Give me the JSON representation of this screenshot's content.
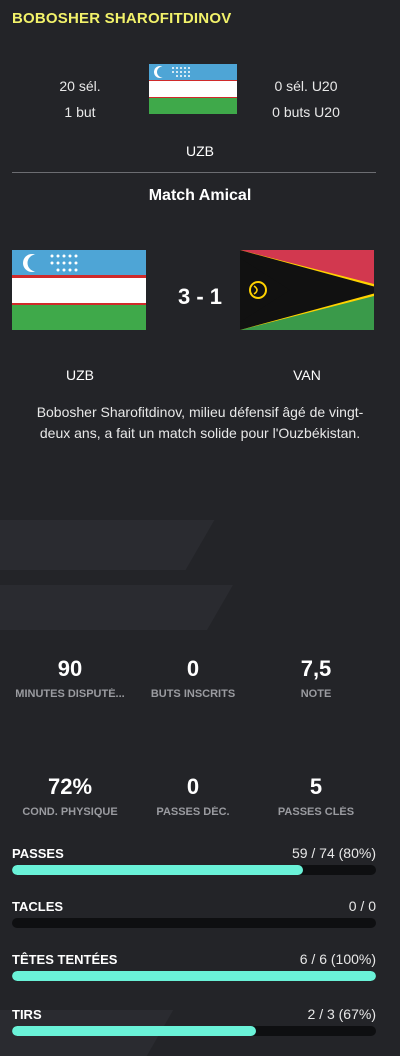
{
  "player": {
    "name": "BOBOSHER SHAROFITDINOV"
  },
  "career": {
    "caps": "20 sél.",
    "goals": "1 but",
    "u20_caps": "0 sél. U20",
    "u20_goals": "0 buts U20",
    "nation_code": "UZB"
  },
  "match": {
    "title": "Match Amical",
    "home_code": "UZB",
    "away_code": "VAN",
    "score": "3 - 1",
    "description": "Bobosher Sharofitdinov, milieu défensif âgé de vingt-deux ans, a fait un match solide pour l'Ouzbékistan."
  },
  "kpis_row1": [
    {
      "value": "90",
      "label": "MINUTES DISPUTÉ..."
    },
    {
      "value": "0",
      "label": "BUTS INSCRITS"
    },
    {
      "value": "7,5",
      "label": "NOTE"
    }
  ],
  "kpis_row2": [
    {
      "value": "72%",
      "label": "COND. PHYSIQUE"
    },
    {
      "value": "0",
      "label": "PASSES DÉC."
    },
    {
      "value": "5",
      "label": "PASSES CLÉS"
    }
  ],
  "bars": [
    {
      "label": "PASSES",
      "value": "59 / 74 (80%)",
      "fraction": 0.8
    },
    {
      "label": "TACLES",
      "value": "0 / 0",
      "fraction": 0
    },
    {
      "label": "TÊTES TENTÉES",
      "value": "6 / 6 (100%)",
      "fraction": 1.0
    },
    {
      "label": "TIRS",
      "value": "2 / 3 (67%)",
      "fraction": 0.67
    }
  ],
  "colors": {
    "name": "#f2f26a",
    "bar_fill": "#6af2d8",
    "bar_track": "#0e0f11",
    "background": "#232428"
  },
  "icons": {
    "home_flag": "uzbekistan-flag-icon",
    "away_flag": "vanuatu-flag-icon"
  }
}
